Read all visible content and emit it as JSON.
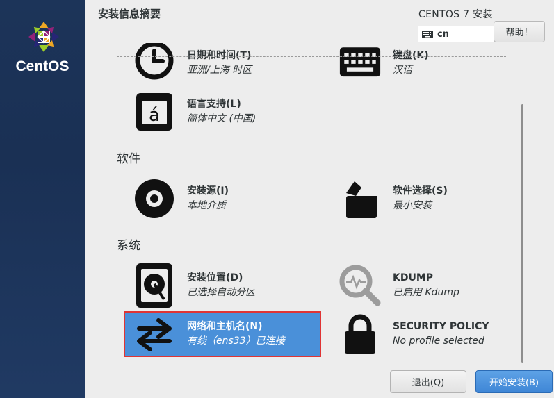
{
  "brand": {
    "name": "CentOS",
    "logo_icon": "centos-logo-icon"
  },
  "header": {
    "title": "安装信息摘要",
    "product": "CENTOS 7 安装",
    "keyboard_layout": "cn",
    "help_label": "帮助！"
  },
  "colors": {
    "sidebar": "#1c3459",
    "selected": "#4a90d9",
    "selected_outline": "#e03434",
    "primary_button": "#4a90d9"
  },
  "sections": {
    "software_label": "软件",
    "system_label": "系统"
  },
  "spokes": {
    "datetime": {
      "name": "日期和时间(T)",
      "status": "亚洲/上海 时区",
      "icon": "clock-icon"
    },
    "keyboard": {
      "name": "键盘(K)",
      "status": "汉语",
      "icon": "keyboard-icon"
    },
    "language": {
      "name": "语言支持(L)",
      "status": "简体中文 (中国)",
      "icon": "language-icon"
    },
    "source": {
      "name": "安装源(I)",
      "status": "本地介质",
      "icon": "disc-icon"
    },
    "software": {
      "name": "软件选择(S)",
      "status": "最小安装",
      "icon": "package-icon"
    },
    "destination": {
      "name": "安装位置(D)",
      "status": "已选择自动分区",
      "icon": "harddisk-icon"
    },
    "kdump": {
      "name": "KDUMP",
      "status": "已启用 Kdump",
      "icon": "magnifier-icon"
    },
    "network": {
      "name": "网络和主机名(N)",
      "status": "有线（ens33）已连接",
      "icon": "network-arrows-icon"
    },
    "security": {
      "name": "SECURITY POLICY",
      "status": "No profile selected",
      "icon": "lock-icon"
    }
  },
  "footer": {
    "quit_label": "退出(Q)",
    "begin_label": "开始安装(B)"
  }
}
